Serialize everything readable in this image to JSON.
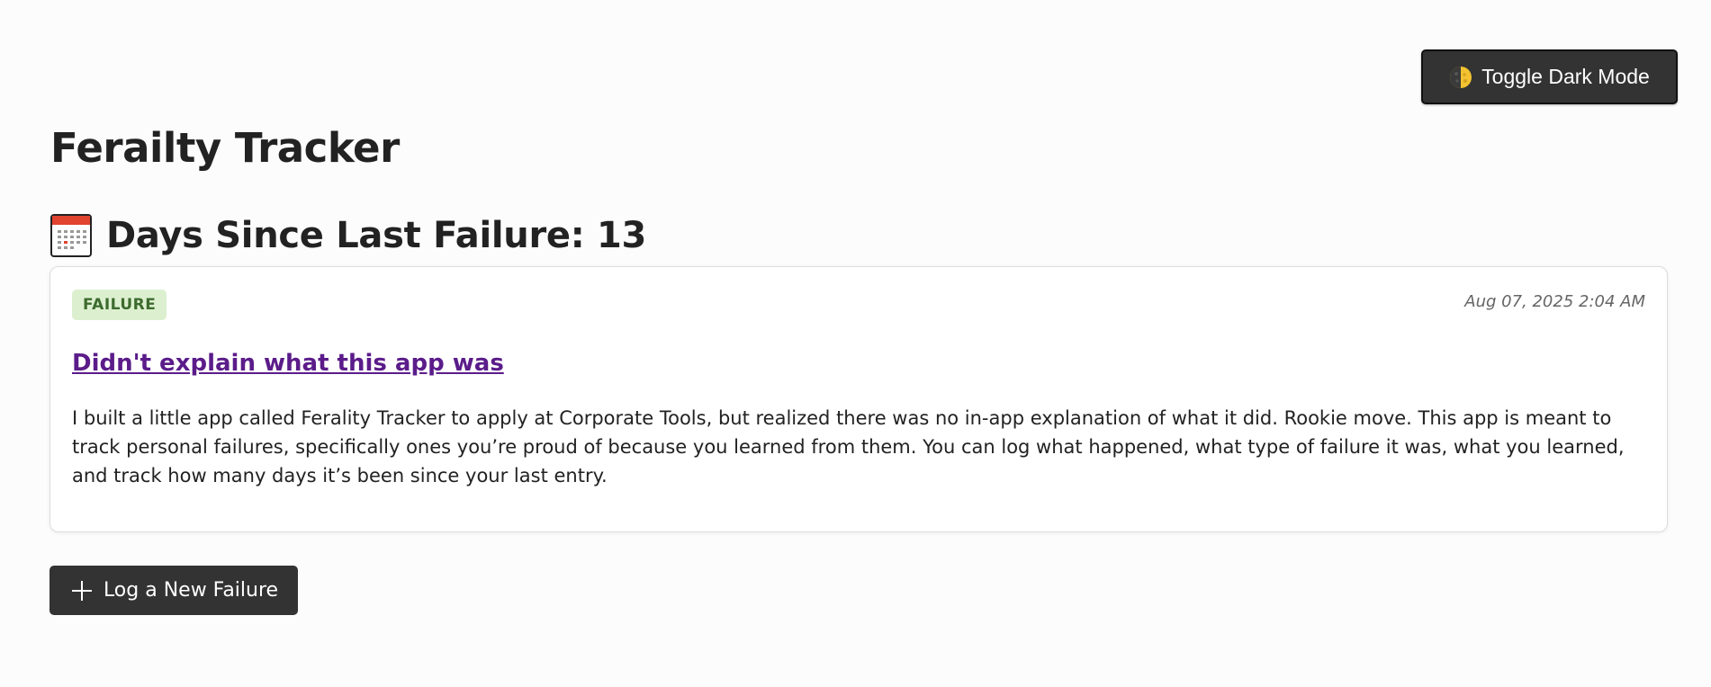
{
  "header": {
    "toggle_label": "Toggle Dark Mode",
    "toggle_icon": "moon-icon"
  },
  "app": {
    "title": "Ferailty Tracker"
  },
  "streak": {
    "icon": "calendar-icon",
    "label": "Days Since Last Failure: 13"
  },
  "entry": {
    "badge": "FAILURE",
    "timestamp": "Aug 07, 2025 2:04 AM",
    "title": "Didn't explain what this app was",
    "body": "I built a little app called Ferality Tracker to apply at Corporate Tools, but realized there was no in-app explanation of what it did. Rookie move. This app is meant to track personal failures, specifically ones you’re proud of because you learned from them. You can log what happened, what type of failure it was, what you learned, and track how many days it’s been since your last entry."
  },
  "actions": {
    "log_label": "Log a New Failure",
    "log_icon": "plus-icon"
  },
  "colors": {
    "button_bg": "#333333",
    "badge_bg": "#dcf0d0",
    "badge_text": "#3d6b2e",
    "link": "#5b1c8a"
  }
}
